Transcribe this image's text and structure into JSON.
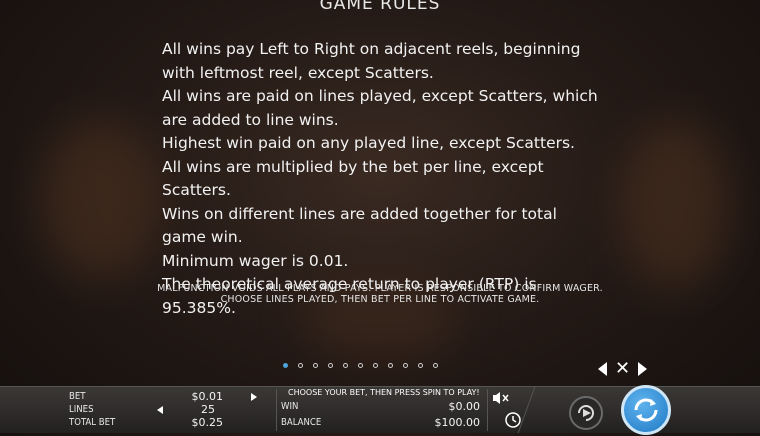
{
  "title": "GAME RULES",
  "rules": [
    "All wins pay Left to Right on adjacent reels, beginning with leftmost reel, except Scatters.",
    "All wins are paid on lines played, except Scatters, which are added to line wins.",
    "Highest win paid on any played line, except Scatters.",
    "All wins are multiplied by the bet per line, except Scatters.",
    "Wins on different lines are added together for total game win.",
    "Minimum wager is 0.01.",
    "The theoretical average return to player (RTP) is 95.385%."
  ],
  "disclaimer": [
    "MALFUNCTION VOIDS ALL PLAYS AND PAYS. PLAYER IS RESPONSIBLE TO CONFIRM WAGER.",
    "CHOOSE LINES PLAYED, THEN BET PER LINE TO ACTIVATE GAME."
  ],
  "pagination": {
    "pages": 11,
    "current": 1
  },
  "bottom_bar": {
    "bet_label": "BET",
    "bet_value": "$0.01",
    "lines_label": "LINES",
    "lines_value": "25",
    "total_bet_label": "TOTAL BET",
    "total_bet_value": "$0.25",
    "message": "CHOOSE YOUR BET, THEN PRESS SPIN TO PLAY!",
    "win_label": "WIN",
    "win_value": "$0.00",
    "balance_label": "BALANCE",
    "balance_value": "$100.00"
  },
  "icons": {
    "prev": "triangle-left-icon",
    "close": "close-icon",
    "next": "triangle-right-icon",
    "sound": "speaker-muted-icon",
    "history": "history-icon",
    "autoplay": "autoplay-icon",
    "spin": "spin-icon"
  },
  "colors": {
    "accent": "#4fa3d8",
    "spin_button": "#2f8fd8"
  }
}
